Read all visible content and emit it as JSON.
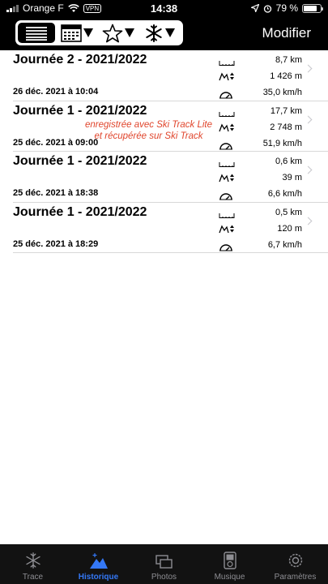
{
  "status": {
    "carrier": "Orange F",
    "vpn": "VPN",
    "time": "14:38",
    "battery": "79 %",
    "battery_level": 0.79
  },
  "toolbar": {
    "modifier_label": "Modifier"
  },
  "colors": {
    "accent": "#3478f6",
    "note": "#e0452c"
  },
  "rows": [
    {
      "title": "Journée 2 - 2021/2022",
      "date": "26 déc. 2021 à 10:04",
      "distance": "8,7 km",
      "elevation": "1 426 m",
      "speed": "35,0 km/h"
    },
    {
      "title": "Journée 1 - 2021/2022",
      "date": "25 déc. 2021 à 09:00",
      "distance": "17,7 km",
      "elevation": "2 748 m",
      "speed": "51,9 km/h",
      "note_line1": "enregistrée avec Ski Track  Lite",
      "note_line2": "et récupérée sur Ski Track"
    },
    {
      "title": "Journée 1 - 2021/2022",
      "date": "25 déc. 2021 à 18:38",
      "distance": "0,6 km",
      "elevation": "39 m",
      "speed": "6,6 km/h"
    },
    {
      "title": "Journée 1 - 2021/2022",
      "date": "25 déc. 2021 à 18:29",
      "distance": "0,5 km",
      "elevation": "120 m",
      "speed": "6,7 km/h"
    }
  ],
  "tabs": [
    {
      "label": "Trace",
      "icon": "snowflake-icon"
    },
    {
      "label": "Historique",
      "icon": "mountain-icon",
      "active": true
    },
    {
      "label": "Photos",
      "icon": "photos-icon"
    },
    {
      "label": "Musique",
      "icon": "music-player-icon"
    },
    {
      "label": "Paramètres",
      "icon": "gear-icon"
    }
  ]
}
